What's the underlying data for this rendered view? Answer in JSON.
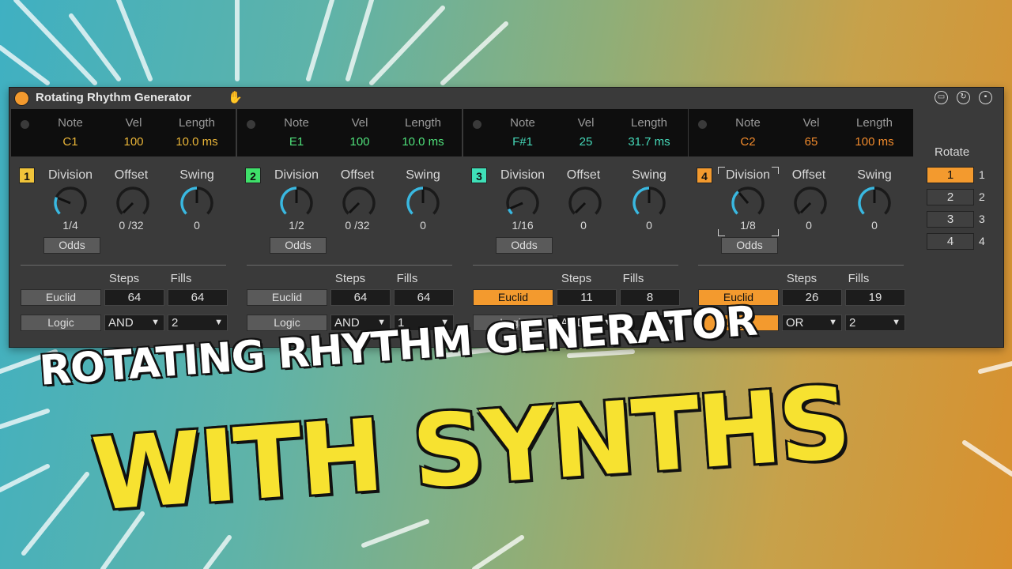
{
  "device": {
    "title": "Rotating Rhythm Generator",
    "hand_icon": "hand-icon",
    "header_labels": {
      "note": "Note",
      "vel": "Vel",
      "length": "Length"
    },
    "knob_labels": {
      "division": "Division",
      "offset": "Offset",
      "swing": "Swing"
    },
    "odds_label": "Odds",
    "steps_label": "Steps",
    "fills_label": "Fills",
    "euclid_label": "Euclid",
    "logic_label": "Logic",
    "lanes": [
      {
        "num": "1",
        "num_color": "#f0c43a",
        "value_color": "#e8b438",
        "note": "C1",
        "vel": "100",
        "length": "10.0 ms",
        "division": "1/4",
        "offset": "0 /32",
        "swing": "0",
        "steps": "64",
        "fills": "64",
        "euclid_on": false,
        "logic_on": false,
        "logic_op": "AND",
        "logic_val": "2"
      },
      {
        "num": "2",
        "num_color": "#3fe06a",
        "value_color": "#4fe07a",
        "note": "E1",
        "vel": "100",
        "length": "10.0 ms",
        "division": "1/2",
        "offset": "0 /32",
        "swing": "0",
        "steps": "64",
        "fills": "64",
        "euclid_on": false,
        "logic_on": false,
        "logic_op": "AND",
        "logic_val": "1"
      },
      {
        "num": "3",
        "num_color": "#3fe0b8",
        "value_color": "#45d8b8",
        "note": "F#1",
        "vel": "25",
        "length": "31.7 ms",
        "division": "1/16",
        "offset": "0",
        "swing": "0",
        "steps": "11",
        "fills": "8",
        "euclid_on": true,
        "logic_on": false,
        "logic_op": "AND",
        "logic_val": "1"
      },
      {
        "num": "4",
        "num_color": "#f39a2e",
        "value_color": "#f08a2c",
        "note": "C2",
        "vel": "65",
        "length": "100 ms",
        "division": "1/8",
        "offset": "0",
        "swing": "0",
        "steps": "26",
        "fills": "19",
        "euclid_on": true,
        "logic_on": true,
        "logic_op": "OR",
        "logic_val": "2"
      }
    ],
    "rotate": {
      "label": "Rotate",
      "buttons": [
        "1",
        "2",
        "3",
        "4"
      ],
      "values": [
        "1",
        "2",
        "3",
        "4"
      ],
      "active_index": 0
    }
  },
  "headline": {
    "line1": "ROTATING RHYTHM GENERATOR",
    "line2": "WITH SYNTHS"
  },
  "colors": {
    "accent": "#f39a2e",
    "knob_arc": "#3ab8e0"
  }
}
